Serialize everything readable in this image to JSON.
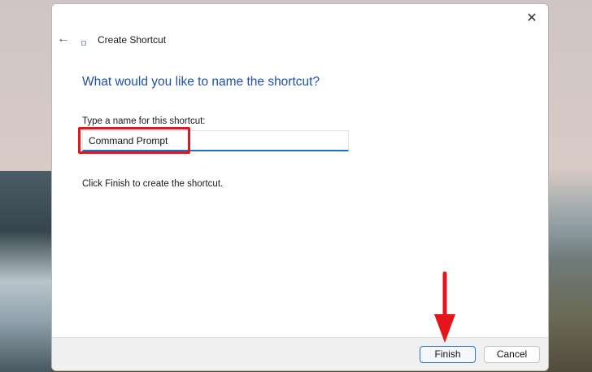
{
  "dialog": {
    "title": "Create Shortcut",
    "heading": "What would you like to name the shortcut?",
    "name_label": "Type a name for this shortcut:",
    "name_value": "Command Prompt",
    "hint": "Click Finish to create the shortcut.",
    "finish_label": "Finish",
    "cancel_label": "Cancel",
    "close_glyph": "✕",
    "back_glyph": "←"
  },
  "annotation": {
    "color": "#e8141b"
  }
}
